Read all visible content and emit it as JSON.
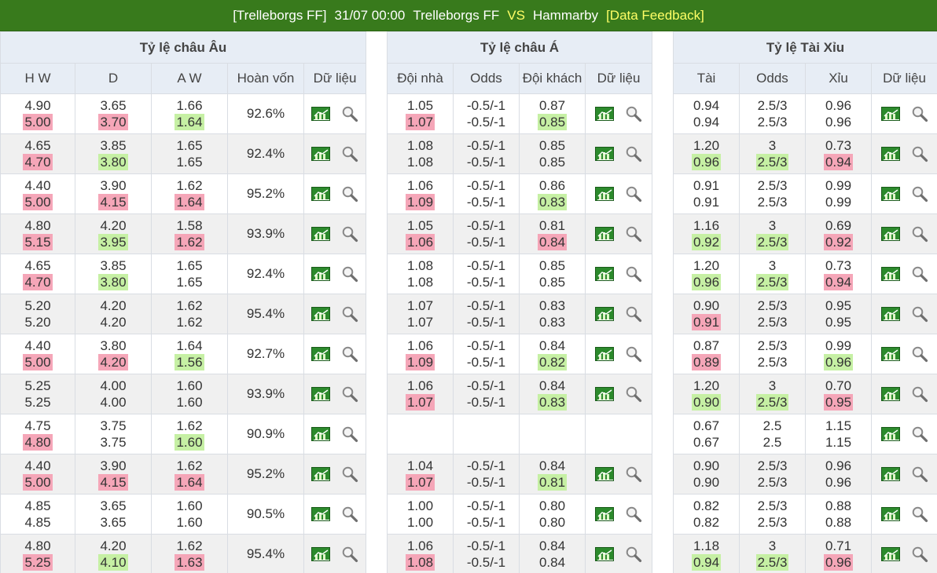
{
  "header": {
    "league": "[Trelleborgs FF]",
    "datetime": "31/07 00:00",
    "home": "Trelleborgs FF",
    "vs": "VS",
    "away": "Hammarby",
    "feedback": "[Data Feedback]"
  },
  "eu": {
    "title": "Tỷ lệ châu Âu",
    "cols": [
      "H W",
      "D",
      "A W",
      "Hoàn vốn",
      "Dữ liệu"
    ],
    "rows": [
      {
        "hw": [
          "4.90",
          "5.00"
        ],
        "hwc": [
          "",
          "up"
        ],
        "d": [
          "3.65",
          "3.70"
        ],
        "dc": [
          "",
          "up"
        ],
        "aw": [
          "1.66",
          "1.64"
        ],
        "awc": [
          "",
          "down"
        ],
        "ret": "92.6%"
      },
      {
        "hw": [
          "4.65",
          "4.70"
        ],
        "hwc": [
          "",
          "up"
        ],
        "d": [
          "3.85",
          "3.80"
        ],
        "dc": [
          "",
          "down"
        ],
        "aw": [
          "1.65",
          "1.65"
        ],
        "awc": [
          "",
          ""
        ],
        "ret": "92.4%"
      },
      {
        "hw": [
          "4.40",
          "5.00"
        ],
        "hwc": [
          "",
          "up"
        ],
        "d": [
          "3.90",
          "4.15"
        ],
        "dc": [
          "",
          "up"
        ],
        "aw": [
          "1.62",
          "1.64"
        ],
        "awc": [
          "",
          "up"
        ],
        "ret": "95.2%"
      },
      {
        "hw": [
          "4.80",
          "5.15"
        ],
        "hwc": [
          "",
          "up"
        ],
        "d": [
          "4.20",
          "3.95"
        ],
        "dc": [
          "",
          "down"
        ],
        "aw": [
          "1.58",
          "1.62"
        ],
        "awc": [
          "",
          "up"
        ],
        "ret": "93.9%"
      },
      {
        "hw": [
          "4.65",
          "4.70"
        ],
        "hwc": [
          "",
          "up"
        ],
        "d": [
          "3.85",
          "3.80"
        ],
        "dc": [
          "",
          "down"
        ],
        "aw": [
          "1.65",
          "1.65"
        ],
        "awc": [
          "",
          ""
        ],
        "ret": "92.4%"
      },
      {
        "hw": [
          "5.20",
          "5.20"
        ],
        "hwc": [
          "",
          ""
        ],
        "d": [
          "4.20",
          "4.20"
        ],
        "dc": [
          "",
          ""
        ],
        "aw": [
          "1.62",
          "1.62"
        ],
        "awc": [
          "",
          ""
        ],
        "ret": "95.4%"
      },
      {
        "hw": [
          "4.40",
          "5.00"
        ],
        "hwc": [
          "",
          "up"
        ],
        "d": [
          "3.80",
          "4.20"
        ],
        "dc": [
          "",
          "up"
        ],
        "aw": [
          "1.64",
          "1.56"
        ],
        "awc": [
          "",
          "down"
        ],
        "ret": "92.7%"
      },
      {
        "hw": [
          "5.25",
          "5.25"
        ],
        "hwc": [
          "",
          ""
        ],
        "d": [
          "4.00",
          "4.00"
        ],
        "dc": [
          "",
          ""
        ],
        "aw": [
          "1.60",
          "1.60"
        ],
        "awc": [
          "",
          ""
        ],
        "ret": "93.9%"
      },
      {
        "hw": [
          "4.75",
          "4.80"
        ],
        "hwc": [
          "",
          "up"
        ],
        "d": [
          "3.75",
          "3.75"
        ],
        "dc": [
          "",
          ""
        ],
        "aw": [
          "1.62",
          "1.60"
        ],
        "awc": [
          "",
          "down"
        ],
        "ret": "90.9%"
      },
      {
        "hw": [
          "4.40",
          "5.00"
        ],
        "hwc": [
          "",
          "up"
        ],
        "d": [
          "3.90",
          "4.15"
        ],
        "dc": [
          "",
          "up"
        ],
        "aw": [
          "1.62",
          "1.64"
        ],
        "awc": [
          "",
          "up"
        ],
        "ret": "95.2%"
      },
      {
        "hw": [
          "4.85",
          "4.85"
        ],
        "hwc": [
          "",
          ""
        ],
        "d": [
          "3.65",
          "3.65"
        ],
        "dc": [
          "",
          ""
        ],
        "aw": [
          "1.60",
          "1.60"
        ],
        "awc": [
          "",
          ""
        ],
        "ret": "90.5%"
      },
      {
        "hw": [
          "4.80",
          "5.25"
        ],
        "hwc": [
          "",
          "up"
        ],
        "d": [
          "4.20",
          "4.10"
        ],
        "dc": [
          "",
          "down"
        ],
        "aw": [
          "1.62",
          "1.63"
        ],
        "awc": [
          "",
          "up"
        ],
        "ret": "95.4%"
      }
    ]
  },
  "asia": {
    "title": "Tỷ lệ châu Á",
    "cols": [
      "Đội nhà",
      "Odds",
      "Đội khách",
      "Dữ liệu"
    ],
    "rows": [
      {
        "h": [
          "1.05",
          "1.07"
        ],
        "hc": [
          "",
          "up"
        ],
        "o": [
          "-0.5/-1",
          "-0.5/-1"
        ],
        "oc": [
          "",
          ""
        ],
        "a": [
          "0.87",
          "0.85"
        ],
        "ac": [
          "",
          "down"
        ],
        "tools": true
      },
      {
        "h": [
          "1.08",
          "1.08"
        ],
        "hc": [
          "",
          ""
        ],
        "o": [
          "-0.5/-1",
          "-0.5/-1"
        ],
        "oc": [
          "",
          ""
        ],
        "a": [
          "0.85",
          "0.85"
        ],
        "ac": [
          "",
          ""
        ],
        "tools": true
      },
      {
        "h": [
          "1.06",
          "1.09"
        ],
        "hc": [
          "",
          "up"
        ],
        "o": [
          "-0.5/-1",
          "-0.5/-1"
        ],
        "oc": [
          "",
          ""
        ],
        "a": [
          "0.86",
          "0.83"
        ],
        "ac": [
          "",
          "down"
        ],
        "tools": true
      },
      {
        "h": [
          "1.05",
          "1.06"
        ],
        "hc": [
          "",
          "up"
        ],
        "o": [
          "-0.5/-1",
          "-0.5/-1"
        ],
        "oc": [
          "",
          ""
        ],
        "a": [
          "0.81",
          "0.84"
        ],
        "ac": [
          "",
          "up"
        ],
        "tools": true
      },
      {
        "h": [
          "1.08",
          "1.08"
        ],
        "hc": [
          "",
          ""
        ],
        "o": [
          "-0.5/-1",
          "-0.5/-1"
        ],
        "oc": [
          "",
          ""
        ],
        "a": [
          "0.85",
          "0.85"
        ],
        "ac": [
          "",
          ""
        ],
        "tools": true
      },
      {
        "h": [
          "1.07",
          "1.07"
        ],
        "hc": [
          "",
          ""
        ],
        "o": [
          "-0.5/-1",
          "-0.5/-1"
        ],
        "oc": [
          "",
          ""
        ],
        "a": [
          "0.83",
          "0.83"
        ],
        "ac": [
          "",
          ""
        ],
        "tools": true
      },
      {
        "h": [
          "1.06",
          "1.09"
        ],
        "hc": [
          "",
          "up"
        ],
        "o": [
          "-0.5/-1",
          "-0.5/-1"
        ],
        "oc": [
          "",
          ""
        ],
        "a": [
          "0.84",
          "0.82"
        ],
        "ac": [
          "",
          "down"
        ],
        "tools": true
      },
      {
        "h": [
          "1.06",
          "1.07"
        ],
        "hc": [
          "",
          "up"
        ],
        "o": [
          "-0.5/-1",
          "-0.5/-1"
        ],
        "oc": [
          "",
          ""
        ],
        "a": [
          "0.84",
          "0.83"
        ],
        "ac": [
          "",
          "down"
        ],
        "tools": true
      },
      {
        "h": [
          "",
          ""
        ],
        "hc": [
          "",
          ""
        ],
        "o": [
          "",
          ""
        ],
        "oc": [
          "",
          ""
        ],
        "a": [
          "",
          ""
        ],
        "ac": [
          "",
          ""
        ],
        "tools": false
      },
      {
        "h": [
          "1.04",
          "1.07"
        ],
        "hc": [
          "",
          "up"
        ],
        "o": [
          "-0.5/-1",
          "-0.5/-1"
        ],
        "oc": [
          "",
          ""
        ],
        "a": [
          "0.84",
          "0.81"
        ],
        "ac": [
          "",
          "down"
        ],
        "tools": true
      },
      {
        "h": [
          "1.00",
          "1.00"
        ],
        "hc": [
          "",
          ""
        ],
        "o": [
          "-0.5/-1",
          "-0.5/-1"
        ],
        "oc": [
          "",
          ""
        ],
        "a": [
          "0.80",
          "0.80"
        ],
        "ac": [
          "",
          ""
        ],
        "tools": true
      },
      {
        "h": [
          "1.06",
          "1.08"
        ],
        "hc": [
          "",
          "up"
        ],
        "o": [
          "-0.5/-1",
          "-0.5/-1"
        ],
        "oc": [
          "",
          ""
        ],
        "a": [
          "0.84",
          "0.84"
        ],
        "ac": [
          "",
          ""
        ],
        "tools": true
      }
    ]
  },
  "ou": {
    "title": "Tỷ lệ Tài Xỉu",
    "cols": [
      "Tài",
      "Odds",
      "Xỉu",
      "Dữ liệu"
    ],
    "rows": [
      {
        "t": [
          "0.94",
          "0.94"
        ],
        "tc": [
          "",
          ""
        ],
        "o": [
          "2.5/3",
          "2.5/3"
        ],
        "oc": [
          "",
          ""
        ],
        "x": [
          "0.96",
          "0.96"
        ],
        "xc": [
          "",
          ""
        ]
      },
      {
        "t": [
          "1.20",
          "0.96"
        ],
        "tc": [
          "",
          "down"
        ],
        "o": [
          "3",
          "2.5/3"
        ],
        "oc": [
          "",
          "down"
        ],
        "x": [
          "0.73",
          "0.94"
        ],
        "xc": [
          "",
          "up"
        ]
      },
      {
        "t": [
          "0.91",
          "0.91"
        ],
        "tc": [
          "",
          ""
        ],
        "o": [
          "2.5/3",
          "2.5/3"
        ],
        "oc": [
          "",
          ""
        ],
        "x": [
          "0.99",
          "0.99"
        ],
        "xc": [
          "",
          ""
        ]
      },
      {
        "t": [
          "1.16",
          "0.92"
        ],
        "tc": [
          "",
          "down"
        ],
        "o": [
          "3",
          "2.5/3"
        ],
        "oc": [
          "",
          "down"
        ],
        "x": [
          "0.69",
          "0.92"
        ],
        "xc": [
          "",
          "up"
        ]
      },
      {
        "t": [
          "1.20",
          "0.96"
        ],
        "tc": [
          "",
          "down"
        ],
        "o": [
          "3",
          "2.5/3"
        ],
        "oc": [
          "",
          "down"
        ],
        "x": [
          "0.73",
          "0.94"
        ],
        "xc": [
          "",
          "up"
        ]
      },
      {
        "t": [
          "0.90",
          "0.91"
        ],
        "tc": [
          "",
          "up"
        ],
        "o": [
          "2.5/3",
          "2.5/3"
        ],
        "oc": [
          "",
          ""
        ],
        "x": [
          "0.95",
          "0.95"
        ],
        "xc": [
          "",
          ""
        ]
      },
      {
        "t": [
          "0.87",
          "0.89"
        ],
        "tc": [
          "",
          "up"
        ],
        "o": [
          "2.5/3",
          "2.5/3"
        ],
        "oc": [
          "",
          ""
        ],
        "x": [
          "0.99",
          "0.96"
        ],
        "xc": [
          "",
          "down"
        ]
      },
      {
        "t": [
          "1.20",
          "0.90"
        ],
        "tc": [
          "",
          "down"
        ],
        "o": [
          "3",
          "2.5/3"
        ],
        "oc": [
          "",
          "down"
        ],
        "x": [
          "0.70",
          "0.95"
        ],
        "xc": [
          "",
          "up"
        ]
      },
      {
        "t": [
          "0.67",
          "0.67"
        ],
        "tc": [
          "",
          ""
        ],
        "o": [
          "2.5",
          "2.5"
        ],
        "oc": [
          "",
          ""
        ],
        "x": [
          "1.15",
          "1.15"
        ],
        "xc": [
          "",
          ""
        ]
      },
      {
        "t": [
          "0.90",
          "0.90"
        ],
        "tc": [
          "",
          ""
        ],
        "o": [
          "2.5/3",
          "2.5/3"
        ],
        "oc": [
          "",
          ""
        ],
        "x": [
          "0.96",
          "0.96"
        ],
        "xc": [
          "",
          ""
        ]
      },
      {
        "t": [
          "0.82",
          "0.82"
        ],
        "tc": [
          "",
          ""
        ],
        "o": [
          "2.5/3",
          "2.5/3"
        ],
        "oc": [
          "",
          ""
        ],
        "x": [
          "0.88",
          "0.88"
        ],
        "xc": [
          "",
          ""
        ]
      },
      {
        "t": [
          "1.18",
          "0.94"
        ],
        "tc": [
          "",
          "down"
        ],
        "o": [
          "3",
          "2.5/3"
        ],
        "oc": [
          "",
          "down"
        ],
        "x": [
          "0.71",
          "0.96"
        ],
        "xc": [
          "",
          "up"
        ]
      }
    ]
  },
  "colors": {
    "header_bg": "#387a1c",
    "header_highlight": "#ffff66",
    "odds_up": "#f5a6b8",
    "odds_down": "#c6f0a4",
    "table_head_bg": "#e7edf5"
  },
  "icons": {
    "data_chart": "bar-chart-icon",
    "data_detail": "magnifier-icon"
  }
}
